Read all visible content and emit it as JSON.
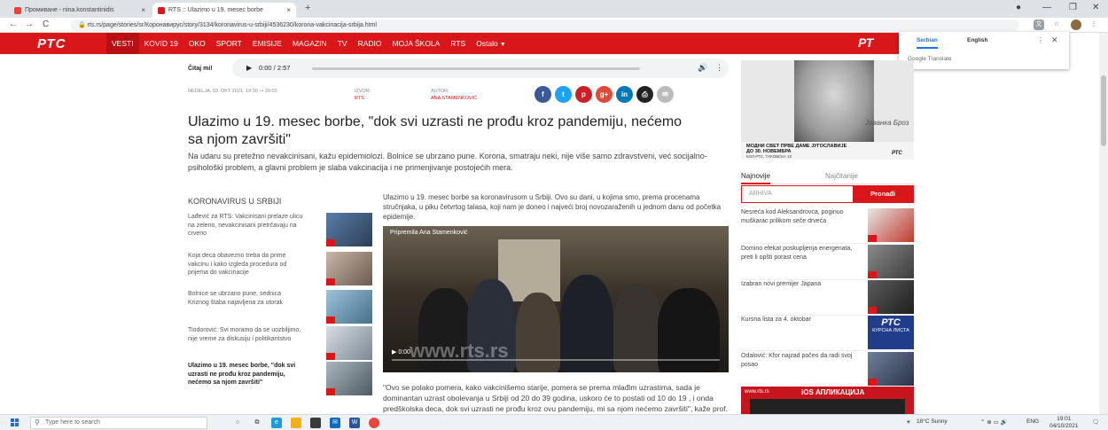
{
  "browser": {
    "tabs": [
      {
        "title": "Промиване - nina.konstantinidis",
        "favicon_color": "#ea4335"
      },
      {
        "title": "RTS :: Ulazimo u 19. mesec borbe",
        "favicon_color": "#d9161a"
      }
    ],
    "new_tab": "+",
    "url": "rts.rs/page/stories/sr/Коронавирус/story/3134/koronavirus-u-srbiji/4536230/korona-vakcinacija-srbija.html",
    "back": "←",
    "forward": "→",
    "reload": "C"
  },
  "site": {
    "logo": "РТС",
    "nav": [
      {
        "label": "VESTI"
      },
      {
        "label": "KOVID 19"
      },
      {
        "label": "OKO"
      },
      {
        "label": "SPORT"
      },
      {
        "label": "EMISIJE"
      },
      {
        "label": "MAGAZIN"
      },
      {
        "label": "TV"
      },
      {
        "label": "RADIO"
      },
      {
        "label": "MOJA ŠKOLA"
      },
      {
        "label": "RTS"
      },
      {
        "label": "Ostalo"
      }
    ],
    "right_logo": "РТ"
  },
  "translate": {
    "lang_source": "Serbian",
    "lang_target": "English",
    "footer": "Google Translate"
  },
  "player": {
    "label": "Čitaj mi!",
    "time": "0:00 / 2:57"
  },
  "article": {
    "date": "NEDELJA, 03. OKT 2021, 19:30 -> 20:03",
    "source_label": "IZVOR:",
    "source": "RTS",
    "author_label": "AUTOR:",
    "author": "ANA STAMENKOVIĆ",
    "title": "Ulazimo u 19. mesec borbe, \"dok svi uzrasti ne prođu kroz pandemiju, nećemo sa njom završiti\"",
    "lead": "Na udaru su pretežno nevakcinisani, kažu epidemiolozi. Bolnice se ubrzano pune. Korona, smatraju neki, nije više samo zdravstveni, već socijalno-psihološki problem, a glavni problem je slaba vakcinacija i ne primenjivanje postojećih mera.",
    "body1": "Ulazimo u 19. mesec borbe sa koronavirusom u Srbiji. Ovo su dani, u kojima smo, prema procenama stručnjaka, u piku četvrtog talasa, koji nam je doneo i najveći broj novozaraženih u jednom danu od početka epidemije.",
    "video_caption": "Pripremila Ana Stamenković",
    "video_time": "0:00",
    "video_watermark": "www.rts.rs",
    "body2": "\"Ovo se polako pomera, kako vakcinišemo starije, pomera se prema mlađim uzrastima, sada je dominantan uzrast obolevanja u Srbiji od 20 do 39 godina, uskoro će to postati od 10 do 19 , i onda predškolska deca, dok svi uzrasti ne prođu kroz ovu pandemiju, mi sa njom nećemo završiti\", kaže prof. dr"
  },
  "share": [
    {
      "icon": "facebook-icon",
      "glyph": "f",
      "color": "#3b5998"
    },
    {
      "icon": "twitter-icon",
      "glyph": "t",
      "color": "#1da1f2"
    },
    {
      "icon": "pinterest-icon",
      "glyph": "p",
      "color": "#cb2027"
    },
    {
      "icon": "google-plus-icon",
      "glyph": "g+",
      "color": "#dd4b39"
    },
    {
      "icon": "linkedin-icon",
      "glyph": "in",
      "color": "#0077b5"
    },
    {
      "icon": "print-icon",
      "glyph": "⎙",
      "color": "#222222"
    },
    {
      "icon": "email-icon",
      "glyph": "✉",
      "color": "#bbbbbb"
    }
  ],
  "related": {
    "heading": "KORONAVIRUS U SRBIJI",
    "items": [
      {
        "text": "Lađević za RTS: Vakcinisani prelaze ulicu na zeleno, nevakcinisani pretrčavaju na crveno"
      },
      {
        "text": "Koja deca obavezno treba da prime vakcinu i kako izgleda procedura od prijema do vakcinacije"
      },
      {
        "text": "Bolnice se ubrzano pune, sednica Kriznog štaba najavljena za utorak"
      },
      {
        "text": "Tiodorović: Svi moramo da se uozbiljimo, nije vreme za diskusiju i politikantstvo"
      },
      {
        "text": "Ulazimo u 19. mesec borbe, \"dok svi uzrasti ne prođu kroz pandemiju, nećemo sa njom završiti\""
      }
    ]
  },
  "sidebar": {
    "promo": {
      "signature": "Јованка Броз",
      "line1": "МОДНИ СВЕТ ПРВЕ ДАМЕ ЈУГОСЛАВИЈЕ",
      "line2": "ДО 30. НОВЕМБРА",
      "line3": "КОЛ.РТС, ТАКОВСКА 10",
      "logo": "РТС"
    },
    "tab_latest": "Najnovije",
    "tab_popular": "Najčitanije",
    "archive_placeholder": "ARHIVA",
    "archive_button": "Pronađi",
    "news": [
      {
        "text": "Nesreća kod Aleksandrovca, poginuo muškarac prilikom seče drveća"
      },
      {
        "text": "Domino efekat poskupljenja energenata, preti li opšti porast cena"
      },
      {
        "text": "Izabran novi premijer Japana"
      },
      {
        "text": "Kursna lista za 4. oktobar",
        "tile_logo": "РТС",
        "tile_text": "КУРСНА ЛИСТА"
      },
      {
        "text": "Odalović: Kfor najzad počeo da radi svoj posao"
      }
    ],
    "app_banner_site": "www.rts.rs",
    "app_banner_title": "iOS АПЛИКАЦИЈА"
  },
  "taskbar": {
    "search_placeholder": "Type here to search",
    "weather": "18°C  Sunny",
    "lang": "ENG",
    "time": "19:01",
    "date": "04/10/2021"
  }
}
